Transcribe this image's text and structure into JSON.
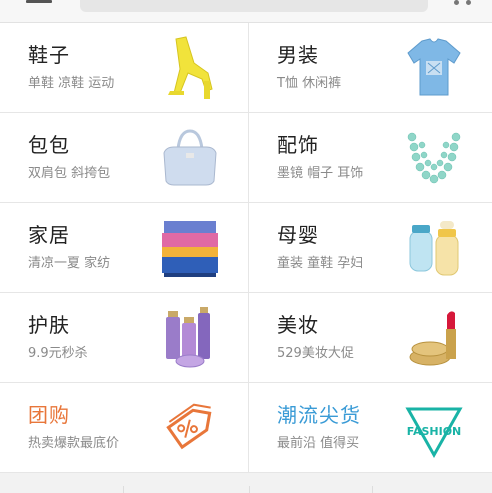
{
  "categories": [
    {
      "title": "鞋子",
      "subtitle": "单鞋 凉鞋 运动",
      "icon": "yellow-sandal-icon"
    },
    {
      "title": "男装",
      "subtitle": "T恤 休闲裤",
      "icon": "blue-tshirt-icon"
    },
    {
      "title": "包包",
      "subtitle": "双肩包 斜挎包",
      "icon": "handbag-icon"
    },
    {
      "title": "配饰",
      "subtitle": "墨镜 帽子 耳饰",
      "icon": "necklace-icon"
    },
    {
      "title": "家居",
      "subtitle": "清凉一夏 家纺",
      "icon": "bedding-icon"
    },
    {
      "title": "母婴",
      "subtitle": "童装 童鞋 孕妇",
      "icon": "baby-bottle-icon"
    },
    {
      "title": "护肤",
      "subtitle": "9.9元秒杀",
      "icon": "skincare-bottles-icon"
    },
    {
      "title": "美妆",
      "subtitle": "529美妆大促",
      "icon": "lipstick-icon"
    },
    {
      "title": "团购",
      "subtitle": "热卖爆款最底价",
      "icon": "discount-tag-icon"
    },
    {
      "title": "潮流尖货",
      "subtitle": "最前沿 值得买",
      "icon": "fashion-triangle-icon",
      "badge_text": "FASHION"
    }
  ],
  "colors": {
    "groupbuy": "#e8763a",
    "trend": "#3a9bd6",
    "fashion": "#19b3a6"
  }
}
